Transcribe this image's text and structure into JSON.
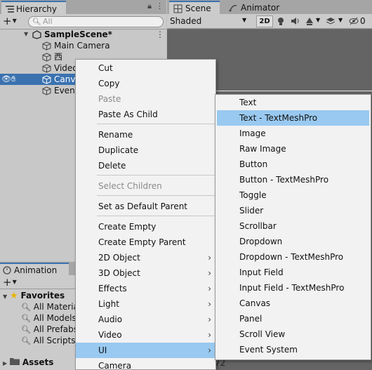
{
  "hierarchy": {
    "tab_label": "Hierarchy",
    "search_placeholder": "All",
    "scene_name": "SampleScene*",
    "items": [
      "Main Camera",
      "西",
      "Video",
      "Canv",
      "Even"
    ]
  },
  "scene_panel": {
    "tabs": [
      "Scene",
      "Animator"
    ],
    "shading_mode": "Shaded",
    "mode_2d": "2D",
    "hidden_count": "0"
  },
  "animation_panel": {
    "tab_label": "Animation",
    "favorites_label": "Favorites",
    "favorites": [
      "All Materia",
      "All Models",
      "All Prefabs",
      "All Scripts"
    ],
    "assets_label": "Assets",
    "partial_number": "72"
  },
  "context_menu": {
    "groups": [
      [
        {
          "label": "Cut",
          "enabled": true
        },
        {
          "label": "Copy",
          "enabled": true
        },
        {
          "label": "Paste",
          "enabled": false
        },
        {
          "label": "Paste As Child",
          "enabled": true
        }
      ],
      [
        {
          "label": "Rename",
          "enabled": true
        },
        {
          "label": "Duplicate",
          "enabled": true
        },
        {
          "label": "Delete",
          "enabled": true
        }
      ],
      [
        {
          "label": "Select Children",
          "enabled": false
        }
      ],
      [
        {
          "label": "Set as Default Parent",
          "enabled": true
        }
      ],
      [
        {
          "label": "Create Empty",
          "enabled": true
        },
        {
          "label": "Create Empty Parent",
          "enabled": true
        },
        {
          "label": "2D Object",
          "enabled": true,
          "submenu": true
        },
        {
          "label": "3D Object",
          "enabled": true,
          "submenu": true
        },
        {
          "label": "Effects",
          "enabled": true,
          "submenu": true
        },
        {
          "label": "Light",
          "enabled": true,
          "submenu": true
        },
        {
          "label": "Audio",
          "enabled": true,
          "submenu": true
        },
        {
          "label": "Video",
          "enabled": true,
          "submenu": true
        },
        {
          "label": "UI",
          "enabled": true,
          "submenu": true,
          "highlighted": true
        },
        {
          "label": "Camera",
          "enabled": true
        }
      ]
    ]
  },
  "ui_submenu": {
    "items": [
      {
        "label": "Text"
      },
      {
        "label": "Text - TextMeshPro",
        "highlighted": true
      },
      {
        "label": "Image"
      },
      {
        "label": "Raw Image"
      },
      {
        "label": "Button"
      },
      {
        "label": "Button - TextMeshPro"
      },
      {
        "label": "Toggle"
      },
      {
        "label": "Slider"
      },
      {
        "label": "Scrollbar"
      },
      {
        "label": "Dropdown"
      },
      {
        "label": "Dropdown - TextMeshPro"
      },
      {
        "label": "Input Field"
      },
      {
        "label": "Input Field - TextMeshPro"
      },
      {
        "label": "Canvas"
      },
      {
        "label": "Panel"
      },
      {
        "label": "Scroll View"
      },
      {
        "label": "Event System"
      }
    ]
  },
  "colors": {
    "selection": "#3a72b0",
    "menu_highlight": "#99c9f0",
    "favorite_star": "#e6b400"
  }
}
